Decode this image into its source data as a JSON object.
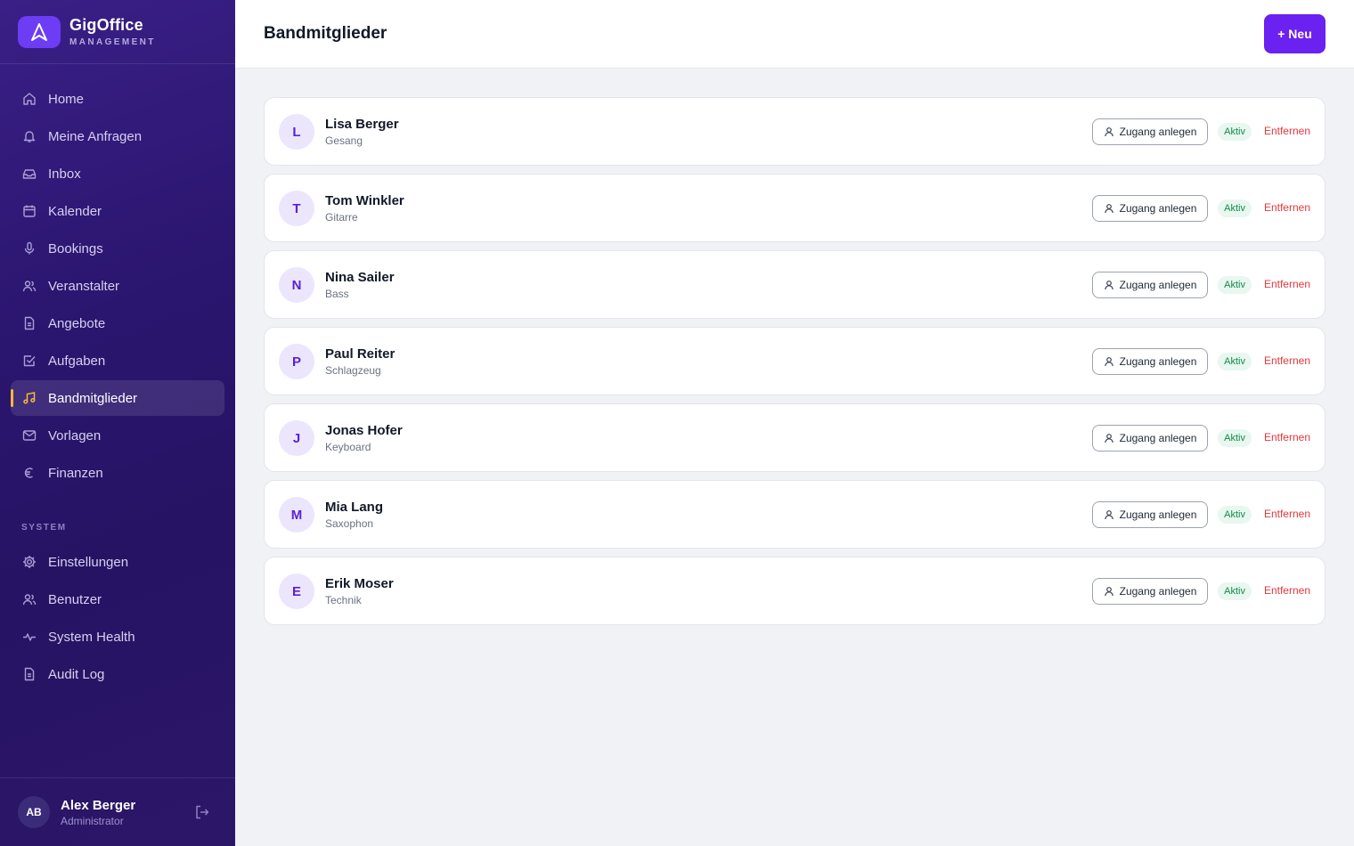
{
  "brand": {
    "name": "GigOffice",
    "subtitle": "MANAGEMENT"
  },
  "nav": [
    {
      "label": "Home",
      "icon": "home-icon",
      "active": false
    },
    {
      "label": "Meine Anfragen",
      "icon": "bell-icon",
      "active": false
    },
    {
      "label": "Inbox",
      "icon": "inbox-icon",
      "active": false
    },
    {
      "label": "Kalender",
      "icon": "calendar-icon",
      "active": false
    },
    {
      "label": "Bookings",
      "icon": "microphone-icon",
      "active": false
    },
    {
      "label": "Veranstalter",
      "icon": "users-icon",
      "active": false
    },
    {
      "label": "Angebote",
      "icon": "document-icon",
      "active": false
    },
    {
      "label": "Aufgaben",
      "icon": "checkbox-icon",
      "active": false
    },
    {
      "label": "Bandmitglieder",
      "icon": "music-icon",
      "active": true
    },
    {
      "label": "Vorlagen",
      "icon": "mail-icon",
      "active": false
    },
    {
      "label": "Finanzen",
      "icon": "euro-icon",
      "active": false
    }
  ],
  "system": {
    "heading": "SYSTEM",
    "items": [
      {
        "label": "Einstellungen",
        "icon": "gear-icon"
      },
      {
        "label": "Benutzer",
        "icon": "users-icon"
      },
      {
        "label": "System Health",
        "icon": "pulse-icon"
      },
      {
        "label": "Audit Log",
        "icon": "document-icon"
      }
    ]
  },
  "user": {
    "initials": "AB",
    "name": "Alex Berger",
    "role": "Administrator"
  },
  "header": {
    "title": "Bandmitglieder",
    "new_label": "+ Neu"
  },
  "members": [
    {
      "initial": "L",
      "name": "Lisa Berger",
      "role": "Gesang"
    },
    {
      "initial": "T",
      "name": "Tom Winkler",
      "role": "Gitarre"
    },
    {
      "initial": "N",
      "name": "Nina Sailer",
      "role": "Bass"
    },
    {
      "initial": "P",
      "name": "Paul Reiter",
      "role": "Schlagzeug"
    },
    {
      "initial": "J",
      "name": "Jonas Hofer",
      "role": "Keyboard"
    },
    {
      "initial": "M",
      "name": "Mia Lang",
      "role": "Saxophon"
    },
    {
      "initial": "E",
      "name": "Erik Moser",
      "role": "Technik"
    }
  ],
  "member_actions": {
    "access_label": "Zugang anlegen",
    "status_label": "Aktiv",
    "remove_label": "Entfernen"
  },
  "colors": {
    "accent": "#6b21f0",
    "sidebar": "#2b1670",
    "active_marker": "#f5b63a",
    "status_green": "#138a4a",
    "danger": "#e0383e"
  }
}
